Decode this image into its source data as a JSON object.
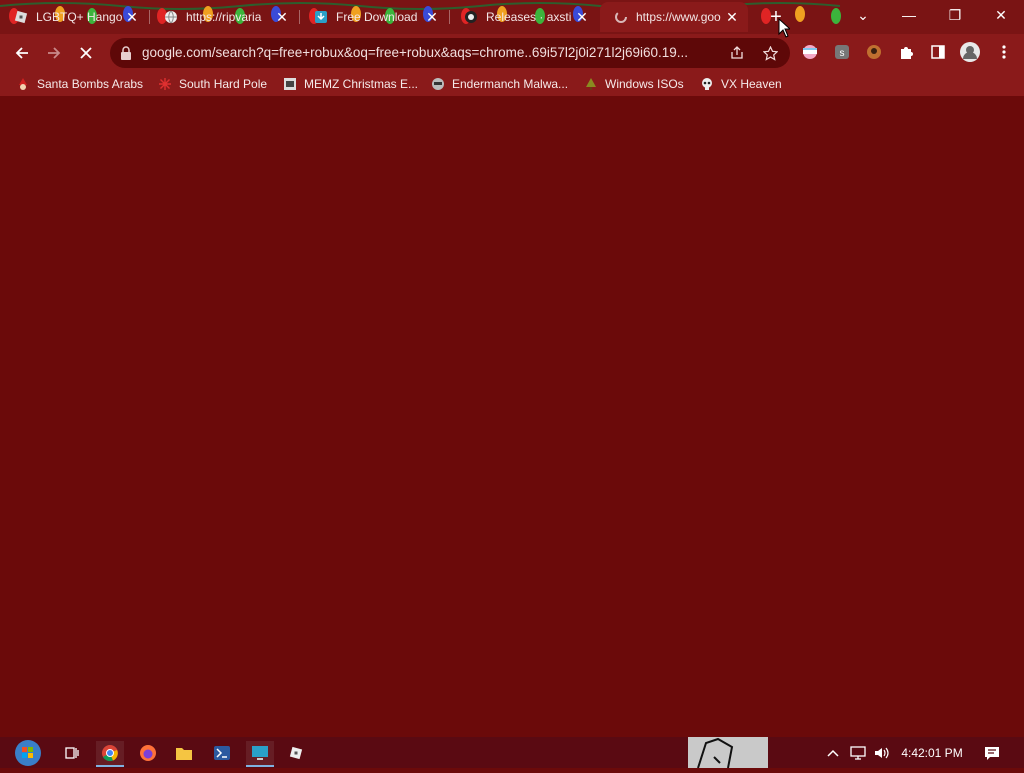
{
  "tabs": [
    {
      "title": "LGBTQ+ Hango",
      "favicon": "roblox-icon",
      "active": false
    },
    {
      "title": "https://ripvaria",
      "favicon": "globe-icon",
      "active": false
    },
    {
      "title": "Free Download",
      "favicon": "download-site-icon",
      "active": false
    },
    {
      "title": "Releases · axsti",
      "favicon": "github-icon",
      "active": false
    },
    {
      "title": "https://www.goo",
      "favicon": "loading-icon",
      "active": true
    }
  ],
  "tab_close_glyph": "✕",
  "new_tab_glyph": "+",
  "window_controls": {
    "tab_search": "⌄",
    "minimize": "—",
    "restore": "❐",
    "close": "✕"
  },
  "toolbar": {
    "url": "google.com/search?q=free+robux&oq=free+robux&aqs=chrome..69i57l2j0i271l2j69i60.19..."
  },
  "bookmarks": [
    {
      "label": "Santa Bombs Arabs",
      "icon": "santa-icon"
    },
    {
      "label": "South Hard Pole",
      "icon": "snowflake-icon"
    },
    {
      "label": "MEMZ Christmas E...",
      "icon": "memz-icon"
    },
    {
      "label": "Endermanch Malwa...",
      "icon": "raccoon-icon"
    },
    {
      "label": "Windows ISOs",
      "icon": "tree-icon"
    },
    {
      "label": "VX Heaven",
      "icon": "skull-icon"
    }
  ],
  "taskbar": {
    "clock": "4:42:01 PM",
    "apps": [
      "start-orb-icon",
      "task-view-icon",
      "chrome-icon",
      "firefox-icon",
      "file-explorer-icon",
      "powershell-icon",
      "remote-desktop-icon",
      "roblox-icon"
    ]
  },
  "colors": {
    "background": "#6b0a0a",
    "tabstrip": "#7a1414",
    "toolbar": "#8a1a1a",
    "omnibox": "#5e0808",
    "taskbar": "#5a0a12"
  }
}
